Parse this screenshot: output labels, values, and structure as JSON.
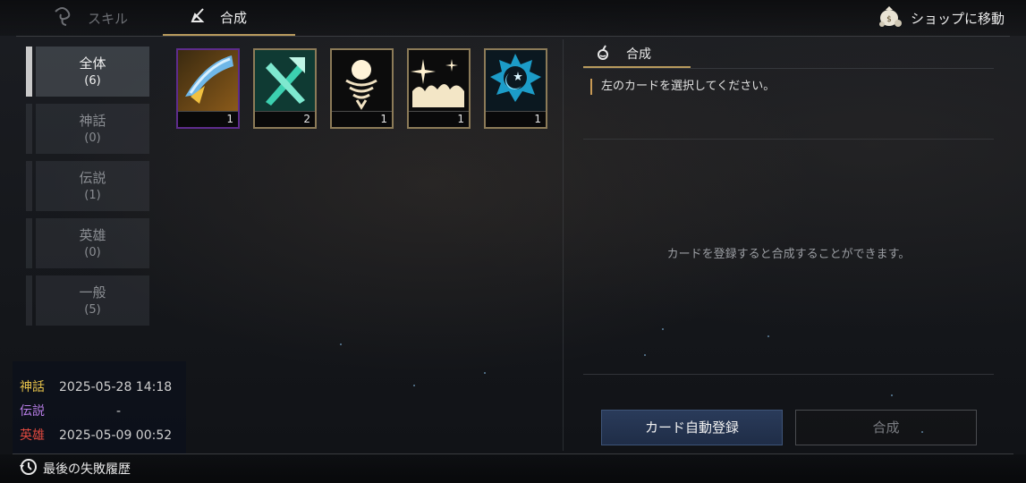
{
  "top_tabs": [
    {
      "label": "スキル",
      "icon": "skill-swirl-icon"
    },
    {
      "label": "合成",
      "icon": "flask-icon"
    }
  ],
  "shop": {
    "label": "ショップに移動",
    "icon": "money-bag-icon"
  },
  "sidebar": {
    "items": [
      {
        "name": "全体",
        "count": "(6)"
      },
      {
        "name": "神話",
        "count": "(0)"
      },
      {
        "name": "伝説",
        "count": "(1)"
      },
      {
        "name": "英雄",
        "count": "(0)"
      },
      {
        "name": "一般",
        "count": "(5)"
      }
    ]
  },
  "cards": [
    {
      "icon": "blue-slash-icon",
      "count": "1"
    },
    {
      "icon": "green-blades-icon",
      "count": "2"
    },
    {
      "icon": "orb-spring-icon",
      "count": "1"
    },
    {
      "icon": "sparkle-flame-icon",
      "count": "1"
    },
    {
      "icon": "star-moon-icon",
      "count": "1"
    }
  ],
  "panel": {
    "tab_label": "合成",
    "instruction": "左のカードを選択してください。",
    "message": "カードを登録すると合成することができます。",
    "auto_register_label": "カード自動登録",
    "craft_label": "合成"
  },
  "history": {
    "rows": [
      {
        "grade": "神話",
        "date": "2025-05-28  14:18",
        "color": "#e6c24a"
      },
      {
        "grade": "伝説",
        "date": "-",
        "color": "#b77de6"
      },
      {
        "grade": "英雄",
        "date": "2025-05-09  00:52",
        "color": "#e0493f"
      }
    ],
    "last_fail_label": "最後の失敗履歴"
  }
}
